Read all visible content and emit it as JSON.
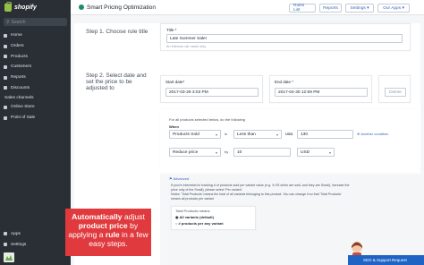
{
  "sidebar": {
    "brand": "shopify",
    "search_placeholder": "Search",
    "items": [
      {
        "label": "Home"
      },
      {
        "label": "Orders"
      },
      {
        "label": "Products"
      },
      {
        "label": "Customers"
      },
      {
        "label": "Reports"
      },
      {
        "label": "Discounts"
      }
    ],
    "channels_label": "Sales channels",
    "channels": [
      {
        "label": "Online Store"
      },
      {
        "label": "Point of Sale"
      }
    ],
    "bottom_items": [
      {
        "label": "Apps"
      },
      {
        "label": "Settings"
      }
    ]
  },
  "topbar": {
    "app_title": "Smart Pricing Optimization",
    "rules_list": "Rules List",
    "reports": "Reports",
    "settings": "Settings ▾",
    "our_apps": "Our Apps ▾"
  },
  "step1": {
    "title": "Step 1. Choose rule title",
    "field_label": "Title *",
    "value": "Late Summer Sale!",
    "hint": "An internal rule name only"
  },
  "step2": {
    "title": "Step 2. Select date and set the price to be adjusted to",
    "start_label": "Start date*",
    "start_value": "2017-03-29 3:03 PM",
    "end_label": "End date *",
    "end_value": "2017-04-30 12:59 PM",
    "delete_label": "Delete",
    "for_text": "For all products selected below, do the following",
    "when_label": "When",
    "condition_field": "Products Sold",
    "condition_op": "is",
    "condition_cmp": "Less than",
    "currency": "USD",
    "condition_value": "130",
    "another_condition": "Another condition",
    "action": "Reduce price",
    "action_by": "by",
    "action_value": "10",
    "action_unit": "USD"
  },
  "advanced": {
    "title": "Advanced",
    "line1": "If you're interested in tracking # of products sold per variant value (e.g. '# XS shirts are sold, and they are Small), increase the",
    "line2": "price only of the Small), please select 'Per variant'.",
    "line3": "Notes: 'Total Products' means the total of all variants belonging to this product. You can change it so that 'Total Products'",
    "line4": "means all products per variant",
    "box_label": "Total Products means",
    "opt1": "All variants (default)",
    "opt2": "# products per any variant"
  },
  "callout": {
    "w1": "Automatically",
    "w2": "adjust",
    "w3": "product price",
    "w4": "by",
    "w5": "applying a",
    "w6": "rule",
    "w7": "in a few easy steps."
  },
  "seo_badge": "SEO & Support Request",
  "colors": {
    "sidebar_bg": "#2a2f35",
    "accent_link": "#3a68b7",
    "callout_red": "#e03a3e",
    "badge_blue": "#1f63c4",
    "brand_green": "#95bf47"
  }
}
